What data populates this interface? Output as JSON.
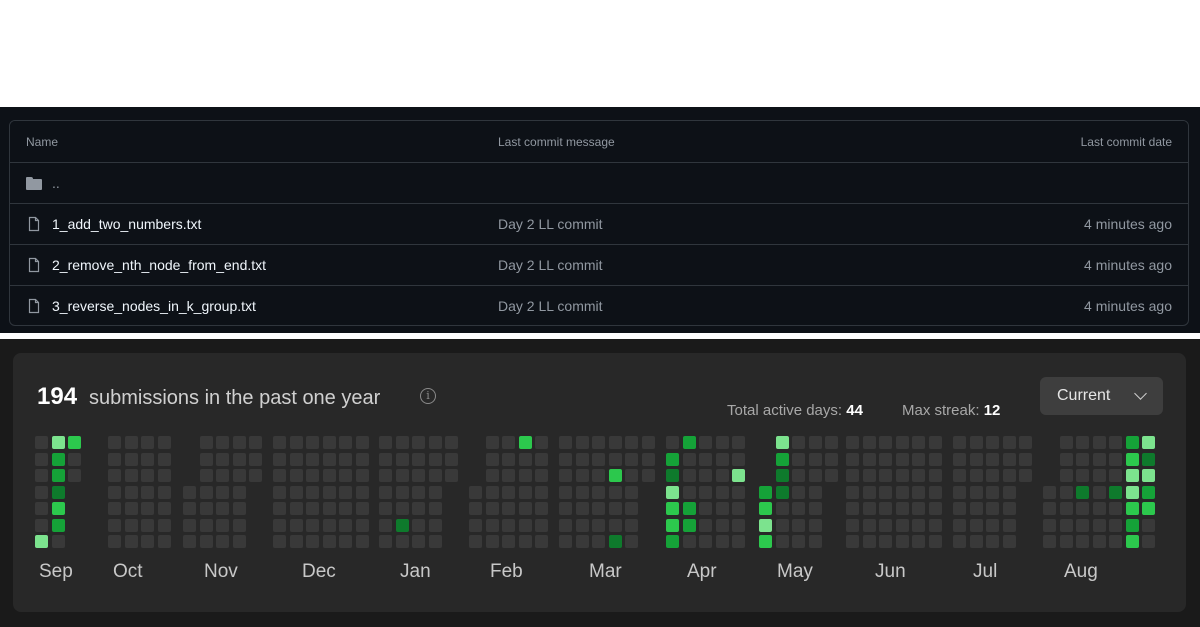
{
  "repo_table": {
    "headers": {
      "name": "Name",
      "message": "Last commit message",
      "date": "Last commit date"
    },
    "parent_dir": "..",
    "files": [
      {
        "name": "1_add_two_numbers.txt",
        "message": "Day 2 LL commit",
        "date": "4 minutes ago"
      },
      {
        "name": "2_remove_nth_node_from_end.txt",
        "message": "Day 2 LL commit",
        "date": "4 minutes ago"
      },
      {
        "name": "3_reverse_nodes_in_k_group.txt",
        "message": "Day 2 LL commit",
        "date": "4 minutes ago"
      }
    ],
    "icons": {
      "folder": "folder-icon",
      "file": "file-icon"
    }
  },
  "calendar": {
    "count": "194",
    "subtitle": "submissions in the past one year",
    "active_days_label": "Total active days:",
    "active_days": "44",
    "streak_label": "Max streak:",
    "streak": "12",
    "dropdown": "Current",
    "months": [
      "Sep",
      "Oct",
      "Nov",
      "Dec",
      "Jan",
      "Feb",
      "Mar",
      "Apr",
      "May",
      "Jun",
      "Jul",
      "Aug"
    ],
    "colors": {
      "empty": "#393939",
      "low": "#0e7a2c",
      "mid": "#15a238",
      "high": "#2cc84d",
      "top": "#7ce38e"
    }
  }
}
